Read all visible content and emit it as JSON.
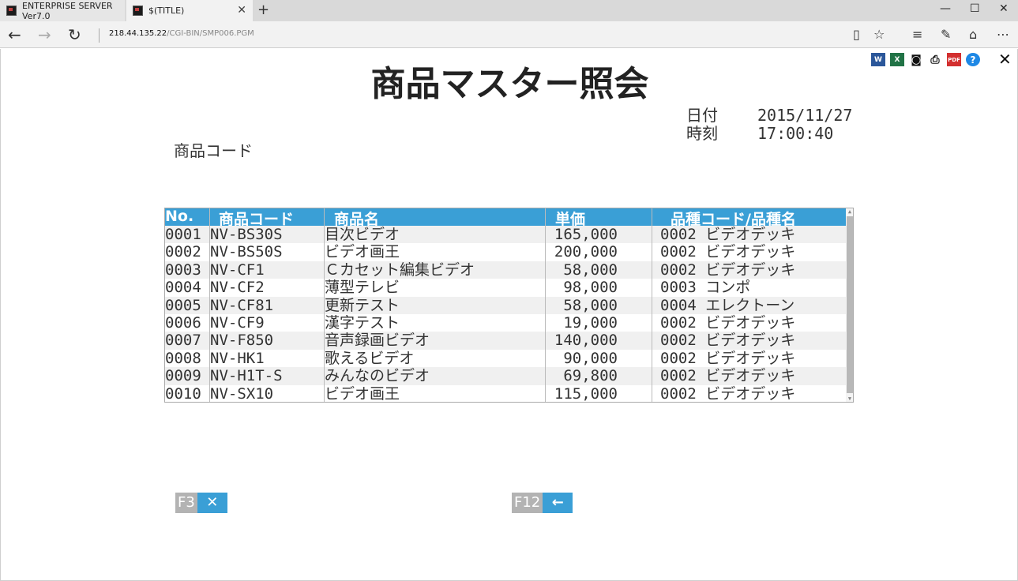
{
  "browser": {
    "tabs": [
      {
        "title": "ENTERPRISE SERVER Ver7.0"
      },
      {
        "title": "$(TITLE)"
      }
    ],
    "address_host": "218.44.135.22",
    "address_path": "/CGI-BIN/SMP006.PGM"
  },
  "page": {
    "title": "商品マスター照会",
    "date_label": "日付",
    "date_value": "2015/11/27",
    "time_label": "時刻",
    "time_value": "17:00:40",
    "code_label": "商品コード",
    "toolbar_icons": [
      "word-icon",
      "excel-icon",
      "camera-icon",
      "print-icon",
      "pdf-icon",
      "help-icon",
      "close-icon"
    ]
  },
  "grid": {
    "headers": [
      "No.",
      "商品コード",
      "商品名",
      "単価",
      "品種コード/品種名"
    ],
    "rows": [
      {
        "no": "0001",
        "code": "NV-BS30S",
        "name": "目次ビデオ",
        "price": "165,000",
        "kind": "0002 ビデオデッキ"
      },
      {
        "no": "0002",
        "code": "NV-BS50S",
        "name": "ビデオ画王",
        "price": "200,000",
        "kind": "0002 ビデオデッキ"
      },
      {
        "no": "0003",
        "code": "NV-CF1",
        "name": "Ｃカセット編集ビデオ",
        "price": "58,000",
        "kind": "0002 ビデオデッキ"
      },
      {
        "no": "0004",
        "code": "NV-CF2",
        "name": "薄型テレビ",
        "price": "98,000",
        "kind": "0003 コンポ"
      },
      {
        "no": "0005",
        "code": "NV-CF81",
        "name": "更新テスト",
        "price": "58,000",
        "kind": "0004 エレクトーン"
      },
      {
        "no": "0006",
        "code": "NV-CF9",
        "name": "漢字テスト",
        "price": "19,000",
        "kind": "0002 ビデオデッキ"
      },
      {
        "no": "0007",
        "code": "NV-F850",
        "name": "音声録画ビデオ",
        "price": "140,000",
        "kind": "0002 ビデオデッキ"
      },
      {
        "no": "0008",
        "code": "NV-HK1",
        "name": "歌えるビデオ",
        "price": "90,000",
        "kind": "0002 ビデオデッキ"
      },
      {
        "no": "0009",
        "code": "NV-H1T-S",
        "name": "みんなのビデオ",
        "price": "69,800",
        "kind": "0002 ビデオデッキ"
      },
      {
        "no": "0010",
        "code": "NV-SX10",
        "name": "ビデオ画王",
        "price": "115,000",
        "kind": "0002 ビデオデッキ"
      }
    ]
  },
  "fkeys": {
    "f3_label": "F3",
    "f3_icon": "close-icon",
    "f12_label": "F12",
    "f12_icon": "arrow-left-icon"
  },
  "colors": {
    "accent": "#3a9fd6",
    "key_gray": "#b3b3b3"
  }
}
